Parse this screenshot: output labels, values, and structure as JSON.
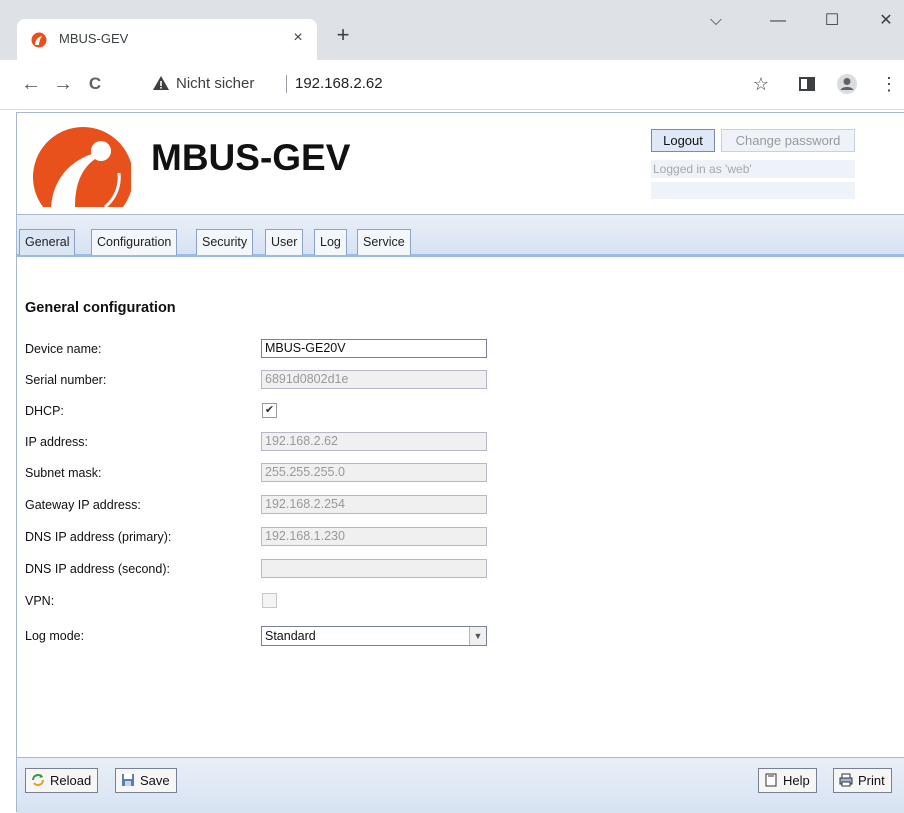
{
  "browser": {
    "tab_title": "MBUS-GEV",
    "close_tab_glyph": "×",
    "new_tab_glyph": "+",
    "window_min": "—",
    "window_max": "☐",
    "window_close": "✕",
    "window_menu": "⌵",
    "security_label": "Nicht sicher",
    "url": "192.168.2.62",
    "back_glyph": "←",
    "forward_glyph": "→",
    "reload_glyph": "C",
    "star_glyph": "☆",
    "menu_glyph": "⋮"
  },
  "header": {
    "brand": "MBUS-GEV",
    "logout": "Logout",
    "change_password": "Change password",
    "logged_in_as": "Logged in as 'web'"
  },
  "tabs": [
    "General",
    "Configuration",
    "Security",
    "User",
    "Log",
    "Service"
  ],
  "active_tab": "General",
  "section_title": "General configuration",
  "fields": {
    "device_name": {
      "label": "Device name:",
      "value": "MBUS-GE20V"
    },
    "serial_number": {
      "label": "Serial number:",
      "value": "6891d0802d1e"
    },
    "dhcp": {
      "label": "DHCP:",
      "checked": true,
      "glyph": "✔"
    },
    "ip_address": {
      "label": "IP address:",
      "value": "192.168.2.62"
    },
    "subnet_mask": {
      "label": "Subnet mask:",
      "value": "255.255.255.0"
    },
    "gateway": {
      "label": "Gateway IP address:",
      "value": "192.168.2.254"
    },
    "dns_primary": {
      "label": "DNS IP address (primary):",
      "value": "192.168.1.230"
    },
    "dns_second": {
      "label": "DNS IP address (second):",
      "value": ""
    },
    "vpn": {
      "label": "VPN:",
      "checked": false
    },
    "log_mode": {
      "label": "Log mode:",
      "value": "Standard",
      "arrow": "▼"
    }
  },
  "footer": {
    "reload": "Reload",
    "save": "Save",
    "help": "Help",
    "print": "Print"
  },
  "colors": {
    "brand_orange": "#e8511c",
    "tab_bar_blue": "#99bbe8"
  }
}
